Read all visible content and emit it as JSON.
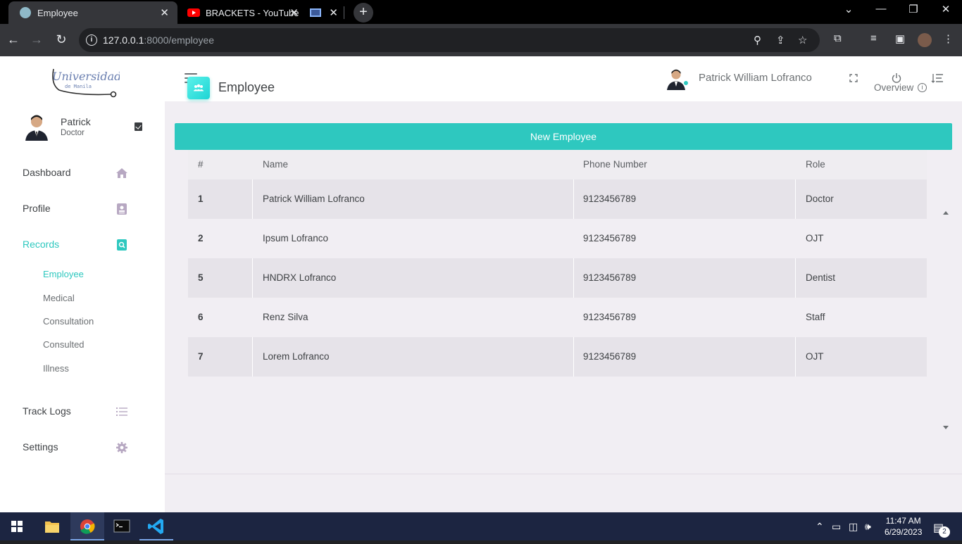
{
  "browser": {
    "tabs": [
      {
        "title": "Employee",
        "active": true
      },
      {
        "title": "BRACKETS - YouTube",
        "active": false
      },
      {
        "title": "",
        "active": false
      }
    ],
    "url_host": "127.0.0.1",
    "url_path": ":8000/employee"
  },
  "sidebar": {
    "logo_text": "Universidad",
    "logo_sub": "de Manila",
    "user": {
      "name": "Patrick",
      "role": "Doctor"
    },
    "nav": [
      {
        "label": "Dashboard",
        "icon": "home-icon"
      },
      {
        "label": "Profile",
        "icon": "contact-card-icon"
      },
      {
        "label": "Records",
        "icon": "search-doc-icon",
        "active": true
      },
      {
        "label": "Track Logs",
        "icon": "list-icon"
      },
      {
        "label": "Settings",
        "icon": "gear-icon"
      }
    ],
    "sub_nav": [
      {
        "label": "Employee",
        "active": true
      },
      {
        "label": "Medical"
      },
      {
        "label": "Consultation"
      },
      {
        "label": "Consulted"
      },
      {
        "label": "Illness"
      }
    ]
  },
  "topbar": {
    "user_name": "Patrick William Lofranco"
  },
  "heading": {
    "title": "Employee",
    "overview_label": "Overview"
  },
  "new_button": {
    "label": "New Employee"
  },
  "table": {
    "headers": [
      "#",
      "Name",
      "Phone Number",
      "Role"
    ],
    "rows": [
      {
        "id": "1",
        "name": "Patrick William Lofranco",
        "phone": "9123456789",
        "role": "Doctor"
      },
      {
        "id": "2",
        "name": "Ipsum Lofranco",
        "phone": "9123456789",
        "role": "OJT"
      },
      {
        "id": "5",
        "name": "HNDRX Lofranco",
        "phone": "9123456789",
        "role": "Dentist"
      },
      {
        "id": "6",
        "name": "Renz Silva",
        "phone": "9123456789",
        "role": "Staff"
      },
      {
        "id": "7",
        "name": "Lorem Lofranco",
        "phone": "9123456789",
        "role": "OJT"
      }
    ]
  },
  "taskbar": {
    "time": "11:47 AM",
    "date": "6/29/2023",
    "notification_count": "2"
  },
  "colors": {
    "accent": "#2ec8bf",
    "sidebar_bg": "#ffffff",
    "content_bg": "#f1eef3",
    "taskbar": "#1c2541"
  }
}
